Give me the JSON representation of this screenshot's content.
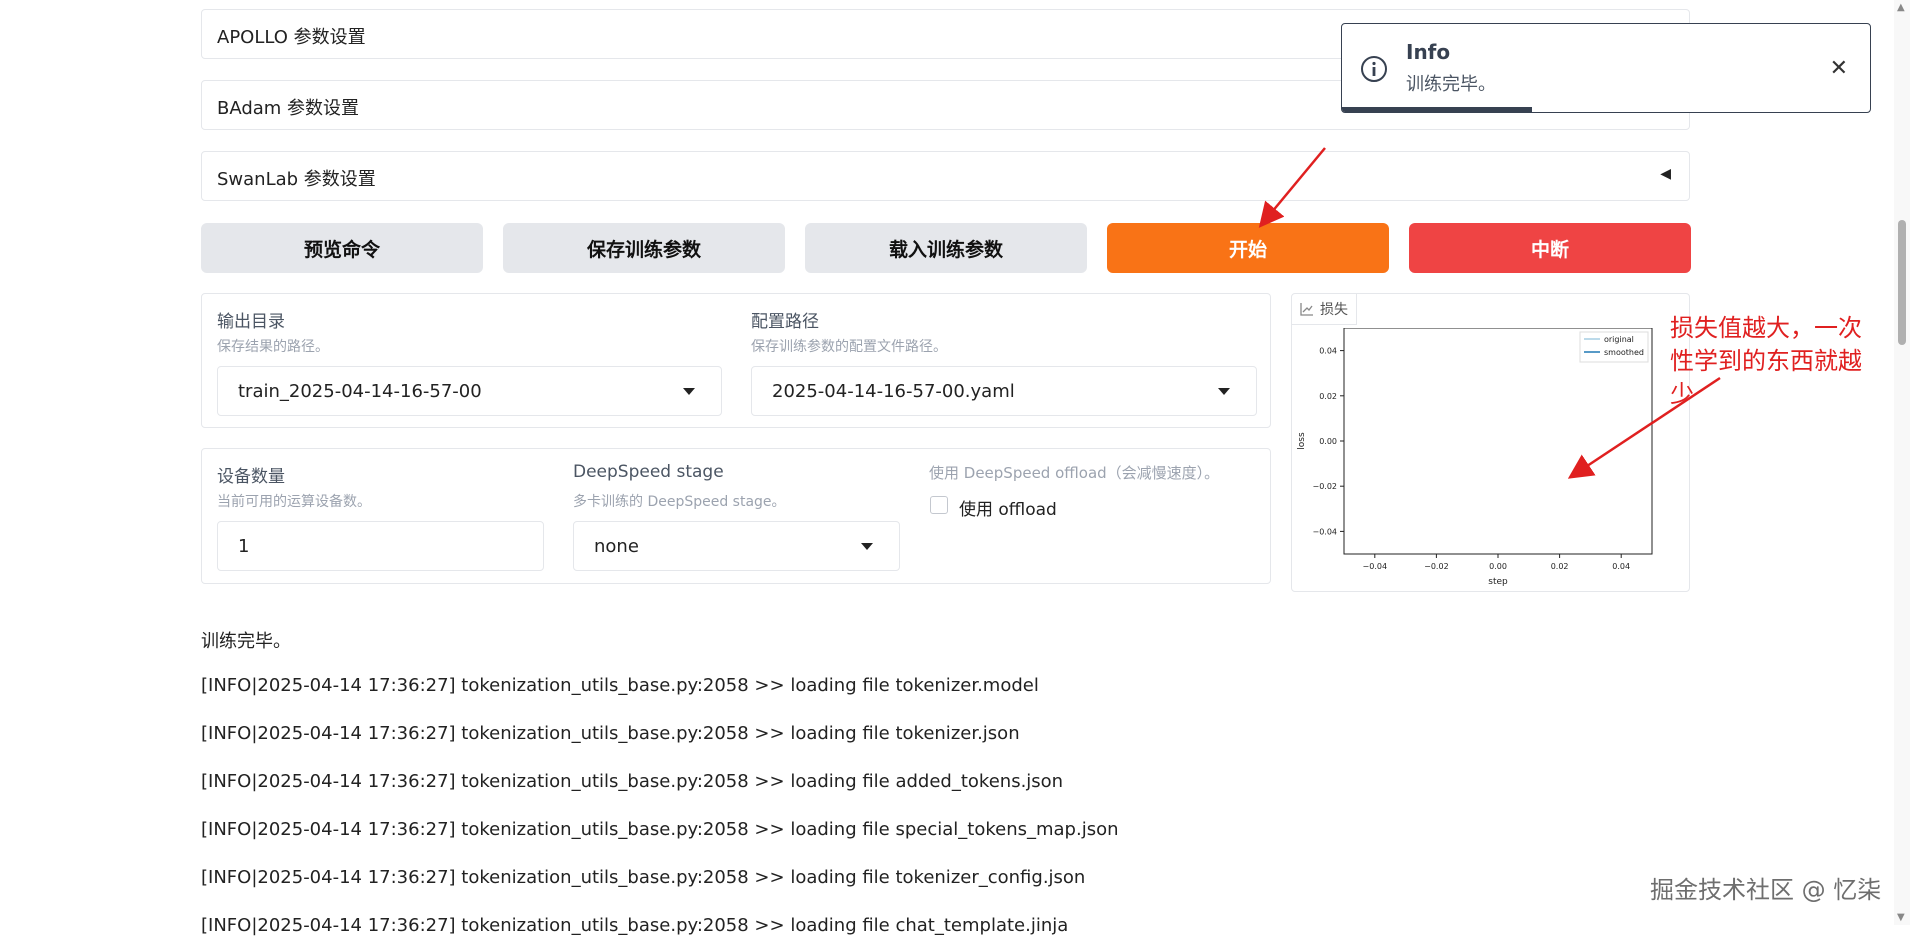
{
  "accordions": [
    {
      "label": "APOLLO 参数设置"
    },
    {
      "label": "BAdam 参数设置"
    },
    {
      "label": "SwanLab 参数设置"
    }
  ],
  "buttons": {
    "preview": "预览命令",
    "save": "保存训练参数",
    "load": "载入训练参数",
    "start": "开始",
    "stop": "中断"
  },
  "output_dir": {
    "label": "输出目录",
    "info": "保存结果的路径。",
    "value": "train_2025-04-14-16-57-00"
  },
  "config_path": {
    "label": "配置路径",
    "info": "保存训练参数的配置文件路径。",
    "value": "2025-04-14-16-57-00.yaml"
  },
  "device_count": {
    "label": "设备数量",
    "info": "当前可用的运算设备数。",
    "value": "1"
  },
  "ds_stage": {
    "label": "DeepSpeed stage",
    "info": "多卡训练的 DeepSpeed stage。",
    "value": "none"
  },
  "ds_offload": {
    "label": "使用 DeepSpeed offload（会减慢速度）。",
    "checkbox_label": "使用 offload",
    "checked": false
  },
  "plot": {
    "tab_label": "损失",
    "icon": "chart-icon"
  },
  "chart_data": {
    "type": "line",
    "title": "",
    "xlabel": "step",
    "ylabel": "loss",
    "xlim": [
      -0.05,
      0.05
    ],
    "ylim": [
      -0.05,
      0.05
    ],
    "xticks": [
      "−0.04",
      "−0.02",
      "0.00",
      "0.02",
      "0.04"
    ],
    "yticks": [
      "0.04",
      "0.02",
      "0.00",
      "−0.02",
      "−0.04"
    ],
    "legend_position": "top-right",
    "series": [
      {
        "name": "original",
        "color": "#a6cee3",
        "values": []
      },
      {
        "name": "smoothed",
        "color": "#1f78b4",
        "values": []
      }
    ]
  },
  "log": {
    "status": "训练完毕。",
    "lines": [
      "[INFO|2025-04-14 17:36:27] tokenization_utils_base.py:2058 >> loading file tokenizer.model",
      "[INFO|2025-04-14 17:36:27] tokenization_utils_base.py:2058 >> loading file tokenizer.json",
      "[INFO|2025-04-14 17:36:27] tokenization_utils_base.py:2058 >> loading file added_tokens.json",
      "[INFO|2025-04-14 17:36:27] tokenization_utils_base.py:2058 >> loading file special_tokens_map.json",
      "[INFO|2025-04-14 17:36:27] tokenization_utils_base.py:2058 >> loading file tokenizer_config.json",
      "[INFO|2025-04-14 17:36:27] tokenization_utils_base.py:2058 >> loading file chat_template.jinja"
    ]
  },
  "toast": {
    "title": "Info",
    "message": "训练完毕。",
    "icon": "info-icon"
  },
  "annotation": "损失值越大，一次性学到的东西就越少",
  "watermark": "掘金技术社区 @ 忆柒",
  "colors": {
    "primary": "#f97316",
    "stop": "#ef4444",
    "secondary": "#e5e7eb",
    "annotation": "#e02020"
  }
}
